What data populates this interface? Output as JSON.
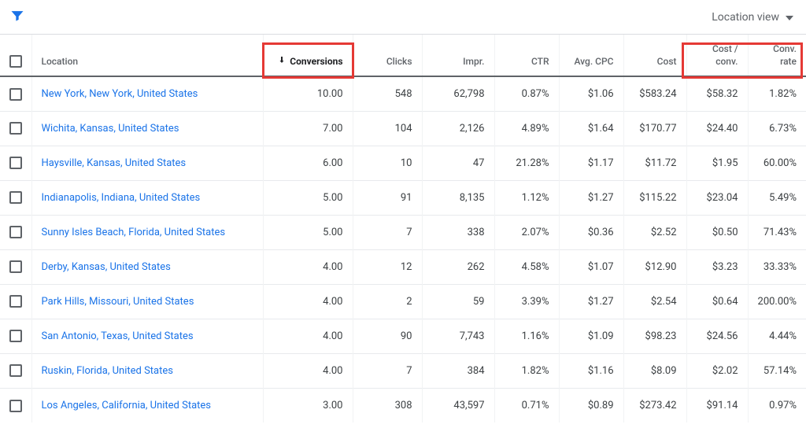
{
  "header": {
    "view_label": "Location view"
  },
  "columns": {
    "location": "Location",
    "conversions": "Conversions",
    "clicks": "Clicks",
    "impr": "Impr.",
    "ctr": "CTR",
    "avg_cpc": "Avg. CPC",
    "cost": "Cost",
    "cost_per_conv_1": "Cost /",
    "cost_per_conv_2": "conv.",
    "conv_rate_1": "Conv.",
    "conv_rate_2": "rate"
  },
  "rows": [
    {
      "location": "New York, New York, United States",
      "conversions": "10.00",
      "clicks": "548",
      "impr": "62,798",
      "ctr": "0.87%",
      "avg_cpc": "$1.06",
      "cost": "$583.24",
      "cost_per_conv": "$58.32",
      "conv_rate": "1.82%"
    },
    {
      "location": "Wichita, Kansas, United States",
      "conversions": "7.00",
      "clicks": "104",
      "impr": "2,126",
      "ctr": "4.89%",
      "avg_cpc": "$1.64",
      "cost": "$170.77",
      "cost_per_conv": "$24.40",
      "conv_rate": "6.73%"
    },
    {
      "location": "Haysville, Kansas, United States",
      "conversions": "6.00",
      "clicks": "10",
      "impr": "47",
      "ctr": "21.28%",
      "avg_cpc": "$1.17",
      "cost": "$11.72",
      "cost_per_conv": "$1.95",
      "conv_rate": "60.00%"
    },
    {
      "location": "Indianapolis, Indiana, United States",
      "conversions": "5.00",
      "clicks": "91",
      "impr": "8,135",
      "ctr": "1.12%",
      "avg_cpc": "$1.27",
      "cost": "$115.22",
      "cost_per_conv": "$23.04",
      "conv_rate": "5.49%"
    },
    {
      "location": "Sunny Isles Beach, Florida, United States",
      "conversions": "5.00",
      "clicks": "7",
      "impr": "338",
      "ctr": "2.07%",
      "avg_cpc": "$0.36",
      "cost": "$2.52",
      "cost_per_conv": "$0.50",
      "conv_rate": "71.43%"
    },
    {
      "location": "Derby, Kansas, United States",
      "conversions": "4.00",
      "clicks": "12",
      "impr": "262",
      "ctr": "4.58%",
      "avg_cpc": "$1.07",
      "cost": "$12.90",
      "cost_per_conv": "$3.23",
      "conv_rate": "33.33%"
    },
    {
      "location": "Park Hills, Missouri, United States",
      "conversions": "4.00",
      "clicks": "2",
      "impr": "59",
      "ctr": "3.39%",
      "avg_cpc": "$1.27",
      "cost": "$2.54",
      "cost_per_conv": "$0.64",
      "conv_rate": "200.00%"
    },
    {
      "location": "San Antonio, Texas, United States",
      "conversions": "4.00",
      "clicks": "90",
      "impr": "7,743",
      "ctr": "1.16%",
      "avg_cpc": "$1.09",
      "cost": "$98.23",
      "cost_per_conv": "$24.56",
      "conv_rate": "4.44%"
    },
    {
      "location": "Ruskin, Florida, United States",
      "conversions": "4.00",
      "clicks": "7",
      "impr": "384",
      "ctr": "1.82%",
      "avg_cpc": "$1.16",
      "cost": "$8.09",
      "cost_per_conv": "$2.02",
      "conv_rate": "57.14%"
    },
    {
      "location": "Los Angeles, California, United States",
      "conversions": "3.00",
      "clicks": "308",
      "impr": "43,597",
      "ctr": "0.71%",
      "avg_cpc": "$0.89",
      "cost": "$273.42",
      "cost_per_conv": "$91.14",
      "conv_rate": "0.97%"
    }
  ]
}
